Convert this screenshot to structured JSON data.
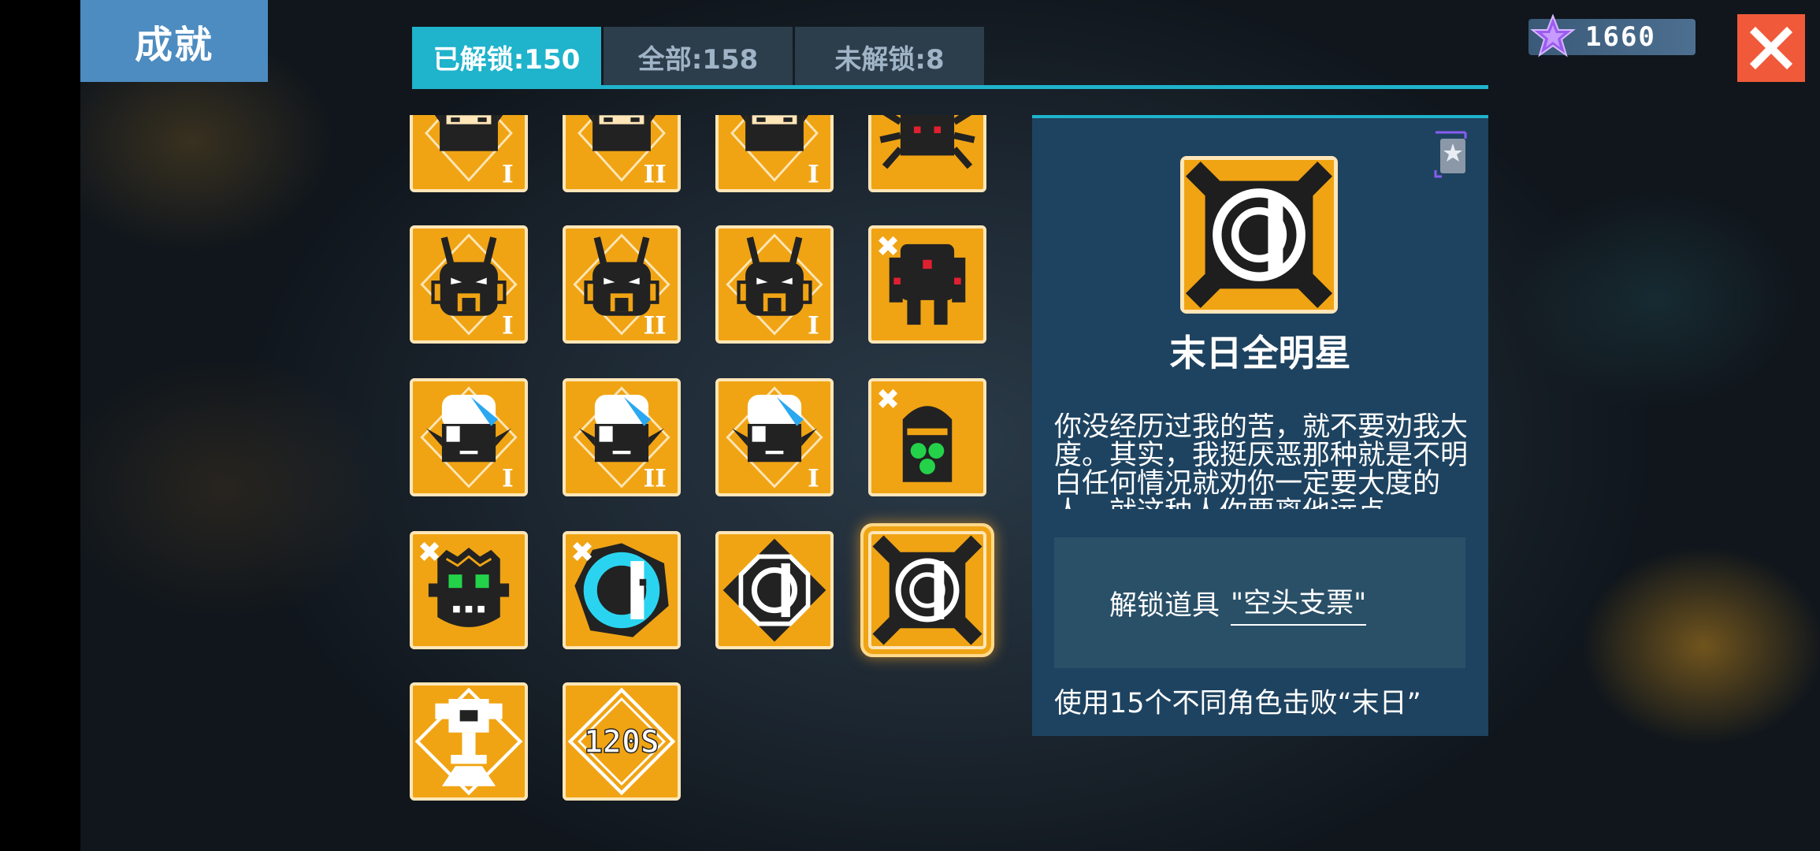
{
  "header": {
    "title": "成就",
    "tabs": [
      {
        "label": "已解锁:150",
        "active": true
      },
      {
        "label": "全部:158",
        "active": false
      },
      {
        "label": "未解锁:8",
        "active": false
      }
    ],
    "currency": {
      "icon": "purple-star-icon",
      "value": "1660"
    },
    "close_icon": "close-icon"
  },
  "colors": {
    "accent": "#1fb3cc",
    "tile": "#f0a414",
    "close": "#f05a3a",
    "title_bg": "#4d8cc0",
    "panel": "#1e4360"
  },
  "achievements": [
    {
      "icon": "ninja-mask-icon",
      "rank": "I",
      "locked": false
    },
    {
      "icon": "ninja-mask-icon",
      "rank": "II",
      "locked": false
    },
    {
      "icon": "ninja-mask-icon",
      "rank": "I",
      "locked": false
    },
    {
      "icon": "red-spider-icon",
      "rank": "",
      "locked": false
    },
    {
      "icon": "knight-helmet-icon",
      "rank": "I",
      "locked": false
    },
    {
      "icon": "knight-helmet-icon",
      "rank": "II",
      "locked": false
    },
    {
      "icon": "knight-helmet-icon",
      "rank": "I",
      "locked": false
    },
    {
      "icon": "red-mech-icon",
      "rank": "",
      "locked": true
    },
    {
      "icon": "white-hair-elf-icon",
      "rank": "I",
      "locked": false
    },
    {
      "icon": "white-hair-elf-icon",
      "rank": "II",
      "locked": false
    },
    {
      "icon": "white-hair-elf-icon",
      "rank": "I",
      "locked": false
    },
    {
      "icon": "green-eye-ghost-icon",
      "rank": "",
      "locked": true
    },
    {
      "icon": "goblin-face-icon",
      "rank": "",
      "locked": true
    },
    {
      "icon": "cyan-ring-icon",
      "rank": "",
      "locked": true
    },
    {
      "icon": "octagon-emblem-icon",
      "rank": "",
      "locked": false
    },
    {
      "icon": "doomsday-emblem-icon",
      "rank": "",
      "locked": false,
      "selected": true
    },
    {
      "icon": "trophy-icon",
      "rank": "",
      "locked": false
    },
    {
      "icon": "120s-icon",
      "rank": "",
      "locked": false
    }
  ],
  "detail": {
    "name": "末日全明星",
    "description": "你没经历过我的苦，就不要劝我大度。其实，我挺厌恶那种就是不明白任何情况就劝你一定要大度的人，就这种人你要离他远点",
    "reward_label": "解锁道具",
    "reward_value": "\"空头支票\"",
    "condition": "使用15个不同角色击败“末日”",
    "rank_icon": "silver-star-rank-icon"
  }
}
